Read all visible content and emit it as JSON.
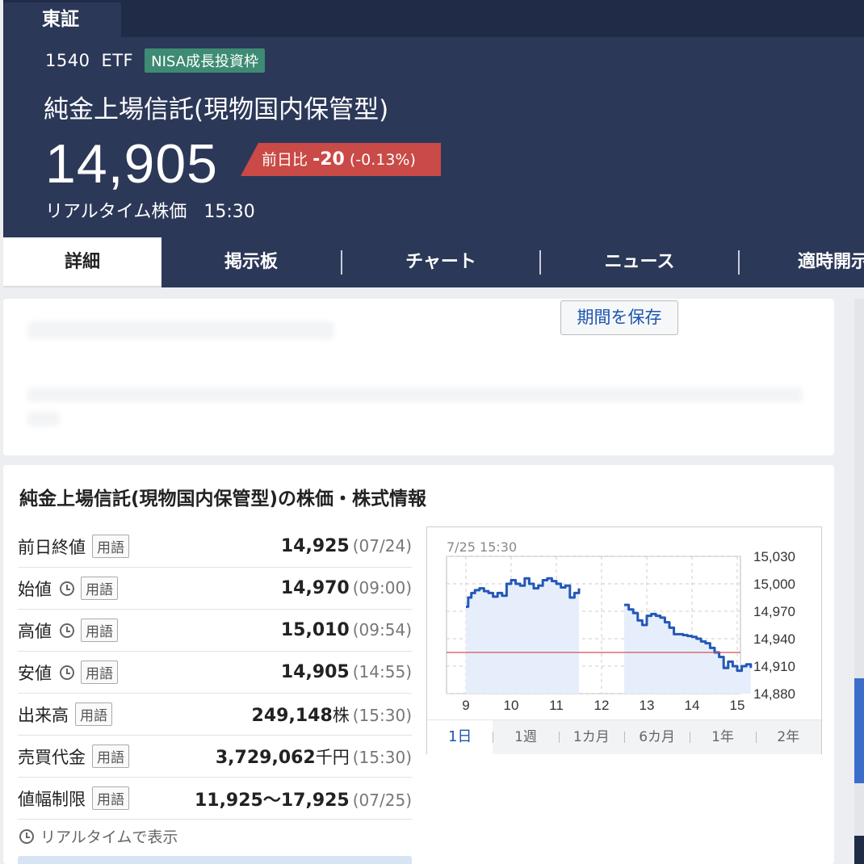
{
  "header": {
    "exchange": "東証",
    "code": "1540",
    "category": "ETF",
    "badge": "NISA成長投資枠",
    "name": "純金上場信託(現物国内保管型)",
    "price": "14,905",
    "change_label": "前日比",
    "change_value": "-20",
    "change_pct": "(-0.13%)",
    "realtime_label": "リアルタイム株価",
    "realtime_time": "15:30"
  },
  "nav": {
    "tabs": [
      {
        "label": "詳細"
      },
      {
        "label": "掲示板"
      },
      {
        "label": "チャート"
      },
      {
        "label": "ニュース"
      },
      {
        "label": "適時開示"
      }
    ]
  },
  "info": {
    "title": "純金上場信託(現物国内保管型)の株価・株式情報",
    "term_label": "用語",
    "rows": [
      {
        "label": "前日終値",
        "value": "14,925",
        "unit": "",
        "time": "(07/24)",
        "clock": false
      },
      {
        "label": "始値",
        "value": "14,970",
        "unit": "",
        "time": "(09:00)",
        "clock": true
      },
      {
        "label": "高値",
        "value": "15,010",
        "unit": "",
        "time": "(09:54)",
        "clock": true
      },
      {
        "label": "安値",
        "value": "14,905",
        "unit": "",
        "time": "(14:55)",
        "clock": true
      },
      {
        "label": "出来高",
        "value": "249,148",
        "unit": "株",
        "time": "(15:30)",
        "clock": false
      },
      {
        "label": "売買代金",
        "value": "3,729,062",
        "unit": "千円",
        "time": "(15:30)",
        "clock": false
      },
      {
        "label": "値幅制限",
        "value": "11,925〜17,925",
        "unit": "",
        "time": "(07/25)",
        "clock": false
      }
    ],
    "realtime_note": "リアルタイムで表示"
  },
  "chart_data": {
    "type": "line",
    "title": "7/25 15:30",
    "xlabel": "",
    "ylabel": "",
    "x_ticks": [
      9,
      10,
      11,
      12,
      13,
      14,
      15
    ],
    "y_ticks": [
      "15,030",
      "15,000",
      "14,970",
      "14,940",
      "14,910",
      "14,880"
    ],
    "y_tick_values": [
      15030,
      15000,
      14970,
      14940,
      14910,
      14880
    ],
    "xlim": [
      9,
      15.5
    ],
    "ylim": [
      14880,
      15030
    ],
    "previous_close": 14925,
    "grid": true,
    "series": [
      {
        "segment": "morning",
        "x": [
          9.0,
          9.05,
          9.12,
          9.2,
          9.3,
          9.4,
          9.5,
          9.6,
          9.7,
          9.8,
          9.9,
          10.0,
          10.1,
          10.2,
          10.3,
          10.4,
          10.5,
          10.6,
          10.7,
          10.8,
          10.9,
          11.0,
          11.1,
          11.2,
          11.3,
          11.4,
          11.5
        ],
        "y": [
          14975,
          14985,
          14990,
          14993,
          14995,
          14992,
          14990,
          14986,
          14990,
          14987,
          15000,
          15004,
          15000,
          14998,
          15006,
          15000,
          14995,
          14998,
          15004,
          15006,
          15003,
          15000,
          14996,
          14998,
          14985,
          14990,
          14995
        ]
      },
      {
        "segment": "afternoon",
        "x": [
          12.5,
          12.6,
          12.7,
          12.8,
          12.9,
          13.0,
          13.1,
          13.2,
          13.3,
          13.4,
          13.5,
          13.6,
          13.7,
          13.8,
          13.9,
          14.0,
          14.1,
          14.2,
          14.3,
          14.4,
          14.5,
          14.6,
          14.7,
          14.8,
          14.9,
          15.0,
          15.1,
          15.2,
          15.3
        ],
        "y": [
          14977,
          14972,
          14968,
          14960,
          14955,
          14965,
          14967,
          14965,
          14963,
          14958,
          14952,
          14945,
          14945,
          14944,
          14943,
          14942,
          14940,
          14937,
          14935,
          14930,
          14925,
          14920,
          14908,
          14915,
          14910,
          14905,
          14910,
          14912,
          14908
        ]
      }
    ]
  },
  "periods": [
    "1日",
    "1週",
    "1カ月",
    "6カ月",
    "1年",
    "2年"
  ],
  "save_label": "期間を保存",
  "colors": {
    "navy": "#2c3858",
    "badge": "#3e8b74",
    "change": "#c94a46",
    "line": "#2358b8",
    "prev_close": "#d0525a"
  }
}
